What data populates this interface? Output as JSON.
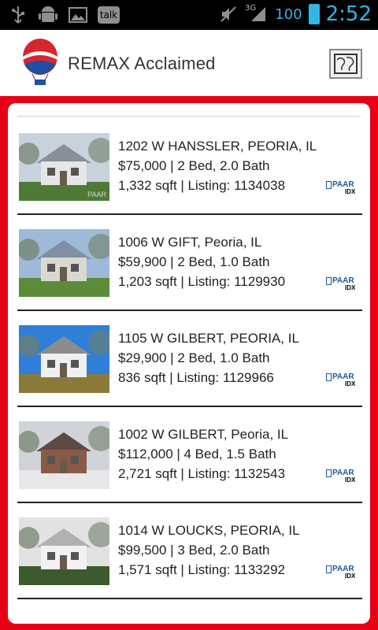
{
  "status_bar": {
    "icons": [
      "usb-icon",
      "android-icon",
      "image-icon",
      "talk-icon"
    ],
    "talk_label": "talk",
    "network": "3G",
    "battery": "100",
    "time": "2:52"
  },
  "app": {
    "title": "REMAX Acclaimed",
    "logo_text": "RE/MAX"
  },
  "listings": [
    {
      "address": "1202 W HANSSLER, PEORIA, IL",
      "price_line": "$75,000 | 2 Bed, 2.0 Bath",
      "size_line": "1,332 sqft | Listing: 1134038",
      "watermark": "PAAR",
      "badge_top": "PAAR",
      "badge_bottom": "IDX",
      "sky": "#c8d2dc",
      "house": "#e6e6e6",
      "roof": "#8a8f96",
      "lawn": "#4f7a36"
    },
    {
      "address": "1006 W GIFT, Peoria, IL",
      "price_line": "$59,900 | 2 Bed, 1.0 Bath",
      "size_line": "1,203 sqft | Listing: 1129930",
      "badge_top": "PAAR",
      "badge_bottom": "IDX",
      "sky": "#9fb9d8",
      "house": "#d9d9cf",
      "roof": "#7f8fa8",
      "lawn": "#5c8b3a"
    },
    {
      "address": "1105 W GILBERT, PEORIA, IL",
      "price_line": "$29,900 | 2 Bed, 1.0 Bath",
      "size_line": "836 sqft | Listing: 1129966",
      "badge_top": "PAAR",
      "badge_bottom": "IDX",
      "sky": "#2f7fd8",
      "house": "#f0f0f0",
      "roof": "#8c8c8c",
      "lawn": "#8a7a3a"
    },
    {
      "address": "1002 W GILBERT, Peoria, IL",
      "price_line": "$112,000 | 4 Bed, 1.5 Bath",
      "size_line": "2,721 sqft | Listing: 1132543",
      "badge_top": "PAAR",
      "badge_bottom": "IDX",
      "sky": "#d0d4d8",
      "house": "#8a5a46",
      "roof": "#5a4a48",
      "lawn": "#e8e8ea"
    },
    {
      "address": "1014 W LOUCKS, PEORIA, IL",
      "price_line": "$99,500 | 3 Bed, 2.0 Bath",
      "size_line": "1,571 sqft | Listing: 1133292",
      "badge_top": "PAAR",
      "badge_bottom": "IDX",
      "sky": "#e2e2e2",
      "house": "#f2f2f2",
      "roof": "#b0b0b0",
      "lawn": "#3c5a2e"
    }
  ],
  "colors": {
    "frame_red": "#e50014",
    "status_blue": "#33b5e5"
  }
}
